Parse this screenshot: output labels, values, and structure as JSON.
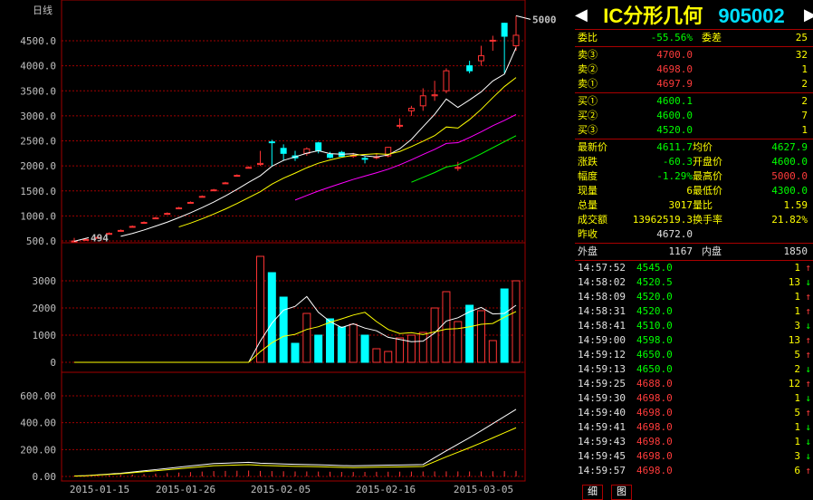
{
  "chart": {
    "period_label": "日线",
    "price_axis": [
      500,
      1000,
      1500,
      2000,
      2500,
      3000,
      3500,
      4000,
      4500
    ],
    "price_axis_labels": [
      "500.0",
      "1000.0",
      "1500.0",
      "2000.0",
      "2500.0",
      "3000.0",
      "3500.0",
      "4000.0",
      "4500.0"
    ],
    "volume_axis_labels": [
      "0",
      "1000",
      "2000",
      "3000"
    ],
    "amount_axis_labels": [
      "0.00",
      "200.00",
      "400.00",
      "600.00"
    ],
    "date_labels": [
      "2015-01-15",
      "2015-01-26",
      "2015-02-05",
      "2015-02-16",
      "2015-03-05"
    ],
    "high_marker": "5000",
    "low_marker": "494",
    "colors": {
      "up": "#ff3333",
      "down": "#00ffff",
      "ma5": "#ffffff",
      "ma10": "#ffff00",
      "ma20": "#ff00ff",
      "ma30": "#00ff00",
      "grid": "#a00000"
    }
  },
  "chart_data": {
    "type": "candlestick",
    "title": "日线",
    "ylim": [
      500,
      5000
    ],
    "candles": [
      {
        "o": 494,
        "c": 500,
        "h": 560,
        "l": 494
      },
      {
        "o": 520,
        "c": 530,
        "h": 560,
        "l": 515
      },
      {
        "o": 560,
        "c": 570,
        "h": 590,
        "l": 555
      },
      {
        "o": 640,
        "c": 650,
        "h": 670,
        "l": 635
      },
      {
        "o": 700,
        "c": 710,
        "h": 730,
        "l": 695
      },
      {
        "o": 780,
        "c": 790,
        "h": 810,
        "l": 775
      },
      {
        "o": 860,
        "c": 870,
        "h": 890,
        "l": 855
      },
      {
        "o": 950,
        "c": 960,
        "h": 980,
        "l": 945
      },
      {
        "o": 1040,
        "c": 1050,
        "h": 1070,
        "l": 1035
      },
      {
        "o": 1150,
        "c": 1160,
        "h": 1180,
        "l": 1145
      },
      {
        "o": 1260,
        "c": 1270,
        "h": 1290,
        "l": 1255
      },
      {
        "o": 1380,
        "c": 1390,
        "h": 1410,
        "l": 1375
      },
      {
        "o": 1510,
        "c": 1520,
        "h": 1540,
        "l": 1505
      },
      {
        "o": 1650,
        "c": 1660,
        "h": 1680,
        "l": 1645
      },
      {
        "o": 1800,
        "c": 1810,
        "h": 1830,
        "l": 1795
      },
      {
        "o": 1960,
        "c": 1970,
        "h": 1990,
        "l": 1955
      },
      {
        "o": 2030,
        "c": 2050,
        "h": 2300,
        "l": 2000
      },
      {
        "o": 2480,
        "c": 2470,
        "h": 2520,
        "l": 2000
      },
      {
        "o": 2350,
        "c": 2250,
        "h": 2430,
        "l": 2100
      },
      {
        "o": 2200,
        "c": 2160,
        "h": 2300,
        "l": 2100
      },
      {
        "o": 2250,
        "c": 2340,
        "h": 2370,
        "l": 2200
      },
      {
        "o": 2460,
        "c": 2300,
        "h": 2480,
        "l": 2250
      },
      {
        "o": 2230,
        "c": 2170,
        "h": 2280,
        "l": 2150
      },
      {
        "o": 2270,
        "c": 2190,
        "h": 2300,
        "l": 2170
      },
      {
        "o": 2190,
        "c": 2210,
        "h": 2260,
        "l": 2160
      },
      {
        "o": 2150,
        "c": 2140,
        "h": 2190,
        "l": 2050
      },
      {
        "o": 2170,
        "c": 2180,
        "h": 2250,
        "l": 2130
      },
      {
        "o": 2200,
        "c": 2370,
        "h": 2380,
        "l": 2170
      },
      {
        "o": 2800,
        "c": 2810,
        "h": 2950,
        "l": 2750
      },
      {
        "o": 3100,
        "c": 3150,
        "h": 3200,
        "l": 3000
      },
      {
        "o": 3200,
        "c": 3400,
        "h": 3550,
        "l": 3100
      },
      {
        "o": 3400,
        "c": 3420,
        "h": 3700,
        "l": 3300
      },
      {
        "o": 3500,
        "c": 3900,
        "h": 3950,
        "l": 3450
      },
      {
        "o": 1950,
        "c": 1970,
        "h": 2080,
        "l": 1900
      },
      {
        "o": 4000,
        "c": 3900,
        "h": 4100,
        "l": 3850
      },
      {
        "o": 4100,
        "c": 4200,
        "h": 4400,
        "l": 4000
      },
      {
        "o": 4500,
        "c": 4510,
        "h": 4600,
        "l": 4300
      },
      {
        "o": 4850,
        "c": 4590,
        "h": 4860,
        "l": 3850
      },
      {
        "o": 4400,
        "c": 4610,
        "h": 5000,
        "l": 4300
      }
    ],
    "volume": [
      0,
      0,
      0,
      0,
      0,
      0,
      0,
      0,
      0,
      0,
      0,
      0,
      0,
      0,
      0,
      0,
      3900,
      3300,
      2400,
      700,
      1800,
      1000,
      1600,
      1300,
      1400,
      1000,
      500,
      400,
      900,
      1000,
      1100,
      2000,
      2600,
      1500,
      2100,
      1900,
      800,
      2700,
      3000
    ],
    "amount": [
      5,
      10,
      20,
      30,
      40,
      55,
      70,
      85,
      100,
      115,
      130,
      145,
      160,
      165,
      170,
      175,
      165,
      160,
      155,
      150,
      148,
      145,
      140,
      135,
      132,
      135,
      138,
      140,
      142,
      145,
      148,
      150,
      152,
      150,
      148,
      150,
      155,
      160,
      165
    ]
  },
  "quote": {
    "title": "IC分形几何",
    "code": "905002",
    "webi": {
      "label": "委比",
      "value": "-55.56%",
      "label2": "委差",
      "value2": "25"
    },
    "sell": [
      {
        "label": "卖③",
        "price": "4700.0",
        "qty": "32"
      },
      {
        "label": "卖②",
        "price": "4698.0",
        "qty": "1"
      },
      {
        "label": "卖①",
        "price": "4697.9",
        "qty": "2"
      }
    ],
    "buy": [
      {
        "label": "买①",
        "price": "4600.1",
        "qty": "2"
      },
      {
        "label": "买②",
        "price": "4600.0",
        "qty": "7"
      },
      {
        "label": "买③",
        "price": "4520.0",
        "qty": "1"
      }
    ],
    "stats": [
      {
        "l1": "最新价",
        "v1": "4611.7",
        "l2": "均价",
        "v2": "4627.9",
        "c1": "green",
        "c2": "green"
      },
      {
        "l1": "涨跌",
        "v1": "-60.3",
        "l2": "开盘价",
        "v2": "4600.0",
        "c1": "green",
        "c2": "green"
      },
      {
        "l1": "幅度",
        "v1": "-1.29%",
        "l2": "最高价",
        "v2": "5000.0",
        "c1": "green",
        "c2": "red"
      },
      {
        "l1": "现量",
        "v1": "6",
        "l2": "最低价",
        "v2": "4300.0",
        "c1": "yellow",
        "c2": "green"
      },
      {
        "l1": "总量",
        "v1": "3017",
        "l2": "量比",
        "v2": "1.59",
        "c1": "yellow",
        "c2": "yellow"
      },
      {
        "l1": "成交额",
        "v1": "13962519.3",
        "l2": "换手率",
        "v2": "21.82%",
        "c1": "yellow",
        "c2": "yellow"
      },
      {
        "l1": "昨收",
        "v1": "4672.0",
        "l2": "",
        "v2": "",
        "c1": "white",
        "c2": "white"
      }
    ],
    "outer": {
      "label": "外盘",
      "value": "1167",
      "label2": "内盘",
      "value2": "1850"
    },
    "ticks": [
      {
        "time": "14:57:52",
        "price": "4545.0",
        "vol": "1",
        "dir": "↑",
        "pc": "green",
        "ac": "red"
      },
      {
        "time": "14:58:02",
        "price": "4520.5",
        "vol": "13",
        "dir": "↓",
        "pc": "green",
        "ac": "green"
      },
      {
        "time": "14:58:09",
        "price": "4520.0",
        "vol": "1",
        "dir": "↑",
        "pc": "green",
        "ac": "red"
      },
      {
        "time": "14:58:31",
        "price": "4520.0",
        "vol": "1",
        "dir": "↑",
        "pc": "green",
        "ac": "red"
      },
      {
        "time": "14:58:41",
        "price": "4510.0",
        "vol": "3",
        "dir": "↓",
        "pc": "green",
        "ac": "green"
      },
      {
        "time": "14:59:00",
        "price": "4598.0",
        "vol": "13",
        "dir": "↑",
        "pc": "green",
        "ac": "red"
      },
      {
        "time": "14:59:12",
        "price": "4650.0",
        "vol": "5",
        "dir": "↑",
        "pc": "green",
        "ac": "red"
      },
      {
        "time": "14:59:13",
        "price": "4650.0",
        "vol": "2",
        "dir": "↓",
        "pc": "green",
        "ac": "green"
      },
      {
        "time": "14:59:25",
        "price": "4688.0",
        "vol": "12",
        "dir": "↑",
        "pc": "red",
        "ac": "red"
      },
      {
        "time": "14:59:30",
        "price": "4698.0",
        "vol": "1",
        "dir": "↓",
        "pc": "red",
        "ac": "green"
      },
      {
        "time": "14:59:40",
        "price": "4698.0",
        "vol": "5",
        "dir": "↑",
        "pc": "red",
        "ac": "red"
      },
      {
        "time": "14:59:41",
        "price": "4698.0",
        "vol": "1",
        "dir": "↓",
        "pc": "red",
        "ac": "green"
      },
      {
        "time": "14:59:43",
        "price": "4698.0",
        "vol": "1",
        "dir": "↓",
        "pc": "red",
        "ac": "green"
      },
      {
        "time": "14:59:45",
        "price": "4698.0",
        "vol": "3",
        "dir": "↓",
        "pc": "red",
        "ac": "green"
      },
      {
        "time": "14:59:57",
        "price": "4698.0",
        "vol": "6",
        "dir": "↑",
        "pc": "red",
        "ac": "red"
      }
    ],
    "tabs": [
      "细",
      "图"
    ]
  }
}
